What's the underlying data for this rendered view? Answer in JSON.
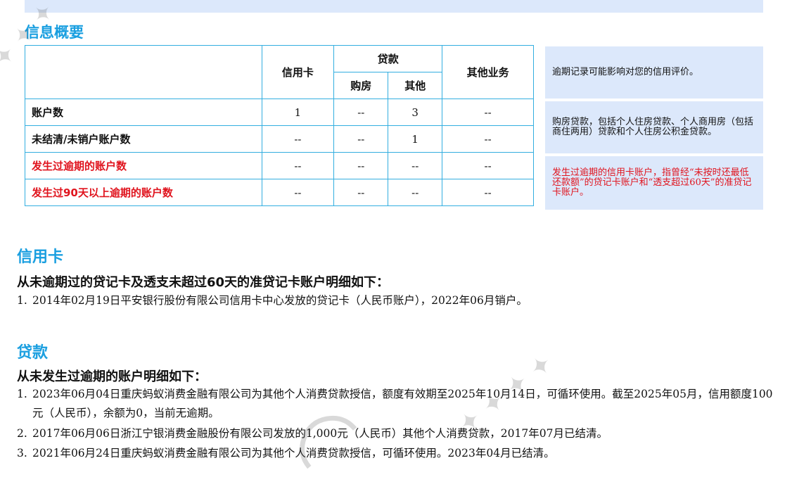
{
  "sections": {
    "overview_title": "信息概要",
    "credit_card_title": "信用卡",
    "loan_title": "贷款"
  },
  "table": {
    "header": {
      "credit_card": "信用卡",
      "loan": "贷款",
      "house": "购房",
      "other": "其他",
      "other_business": "其他业务"
    },
    "rows": [
      {
        "label": "账户数",
        "cells": [
          "1",
          "--",
          "3",
          "--"
        ]
      },
      {
        "label": "未结清/未销户账户数",
        "cells": [
          "--",
          "--",
          "1",
          "--"
        ]
      },
      {
        "label": "发生过逾期的账户数",
        "cells": [
          "--",
          "--",
          "--",
          "--"
        ]
      },
      {
        "label": "发生过90天以上逾期的账户数",
        "cells": [
          "--",
          "--",
          "--",
          "--"
        ]
      }
    ]
  },
  "notes": [
    "逾期记录可能影响对您的信用评价。",
    "购房贷款，包括个人住房贷款、个人商用房（包括商住两用）贷款和个人住房公积金贷款。",
    "发生过逾期的信用卡账户，指曾经“未按时还最低还款额”的贷记卡账户和“透支超过60天”的准贷记卡账户。"
  ],
  "credit_card": {
    "subheading": "从未逾期过的贷记卡及透支未超过60天的准贷记卡账户明细如下：",
    "items": [
      {
        "num": "1.",
        "text": "2014年02月19日平安银行股份有限公司信用卡中心发放的贷记卡（人民币账户），2022年06月销户。"
      }
    ]
  },
  "loan": {
    "subheading": "从未发生过逾期的账户明细如下：",
    "items": [
      {
        "num": "1.",
        "text": "2023年06月04日重庆蚂蚁消费金融有限公司为其他个人消费贷款授信，额度有效期至2025年10月14日，可循环使用。截至2025年05月，信用额度100元（人民币），余额为0，当前无逾期。"
      },
      {
        "num": "2.",
        "text": "2017年06月06日浙江宁银消费金融股份有限公司发放的1,000元（人民币）其他个人消费贷款，2017年07月已结清。"
      },
      {
        "num": "3.",
        "text": "2021年06月24日重庆蚂蚁消费金融有限公司为其他个人消费贷款授信，可循环使用。2023年04月已结清。"
      }
    ]
  }
}
